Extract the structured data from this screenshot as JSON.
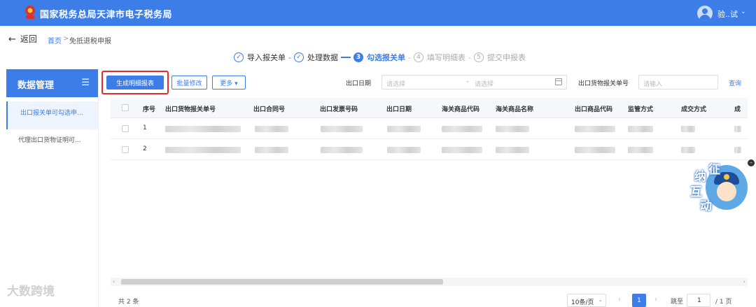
{
  "header": {
    "title": "国家税务总局天津市电子税务局",
    "user_name": "验..试",
    "user_chevron": "⌄"
  },
  "nav": {
    "back_label": "返回",
    "back_arrow": "←",
    "breadcrumb": {
      "home": "首页",
      "sep": ">",
      "current": "免抵退税申报"
    }
  },
  "steps": [
    {
      "num": "✓",
      "label": "导入报关单",
      "state": "done"
    },
    {
      "num": "✓",
      "label": "处理数据",
      "state": "done"
    },
    {
      "num": "3",
      "label": "勾选报关单",
      "state": "active"
    },
    {
      "num": "4",
      "label": "填写明细表",
      "state": "pending"
    },
    {
      "num": "5",
      "label": "提交申报表",
      "state": "pending"
    }
  ],
  "sidebar": {
    "title": "数据管理",
    "menu_icon": "☰",
    "items": [
      {
        "label": "出口报关单可勾选申..."
      },
      {
        "label": "代理出口货物证明可..."
      }
    ]
  },
  "toolbar": {
    "generate_label": "生成明细报表",
    "batch_edit_label": "批量修改",
    "more_label": "更多 ▾",
    "export_date_label": "出口日期",
    "date_start_placeholder": "请选择",
    "date_dash": "-",
    "date_end_placeholder": "请选择",
    "decl_no_label": "出口货物报关单号",
    "decl_no_placeholder": "请输入",
    "query_label": "查询"
  },
  "table": {
    "columns": [
      "序号",
      "出口货物报关单号",
      "出口合同号",
      "出口发票号码",
      "出口日期",
      "海关商品代码",
      "海关商品名称",
      "出口商品代码",
      "监管方式",
      "成交方式",
      "成"
    ],
    "rows": [
      {
        "index": "1"
      },
      {
        "index": "2"
      }
    ]
  },
  "mascot": {
    "chars": [
      "征",
      "纳",
      "互",
      "动"
    ],
    "close": "–"
  },
  "scrollbar": {
    "left": "‹",
    "right": "›"
  },
  "pagination": {
    "total": "共 2 条",
    "page_size": "10条/页",
    "page_size_chevron": "⌄",
    "prev": "‹",
    "current": "1",
    "next": "›",
    "jump_label": "跳至",
    "jump_value": "1",
    "total_pages": "/ 1 页"
  },
  "watermark": "大数跨境",
  "colors": {
    "primary": "#3d7de8",
    "highlight": "#e32c2c"
  }
}
